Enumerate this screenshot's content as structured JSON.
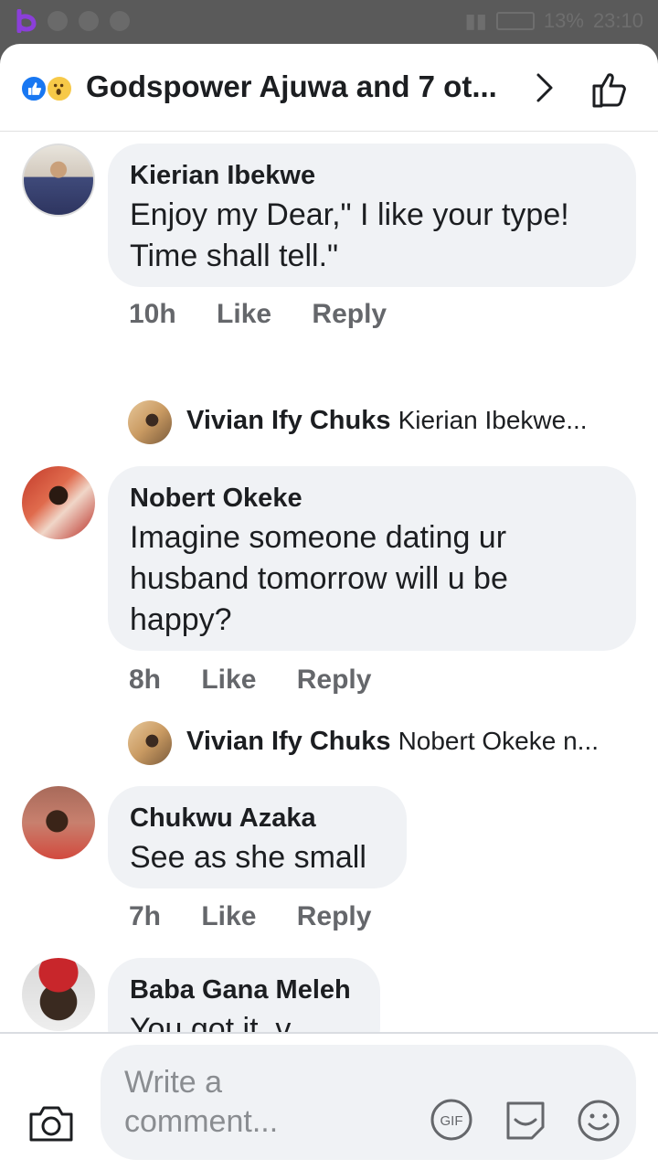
{
  "status_bar": {
    "battery": "13%",
    "time": "23:10"
  },
  "header": {
    "title": "Godspower Ajuwa and 7 ot..."
  },
  "comments": [
    {
      "author": "Kierian Ibekwe",
      "text": "Enjoy my Dear,\" I like your type! Time shall tell.\"",
      "time": "10h",
      "like": "Like",
      "reply": "Reply",
      "replies": [
        {
          "author": "Vivian Ify Chuks",
          "text": "Kierian Ibekwe..."
        }
      ]
    },
    {
      "author": "Nobert Okeke",
      "text": "Imagine someone dating ur husband tomorrow will u be happy?",
      "time": "8h",
      "like": "Like",
      "reply": "Reply",
      "replies": [
        {
          "author": "Vivian Ify Chuks",
          "text": "Nobert Okeke n..."
        }
      ]
    },
    {
      "author": "Chukwu Azaka",
      "text": "See as she small",
      "time": "7h",
      "like": "Like",
      "reply": "Reply"
    },
    {
      "author": "Baba Gana Meleh",
      "text": "You got it ,v"
    }
  ],
  "composer": {
    "placeholder": "Write a comment..."
  },
  "icons": {
    "status": [
      "app-logo-icon",
      "messenger-icon",
      "youtube-icon",
      "gallery-icon",
      "bluetooth-icon",
      "vibrate-icon",
      "wifi-icon",
      "signal-icon",
      "battery-icon"
    ],
    "header": [
      "like-reaction-icon",
      "wow-reaction-icon",
      "chevron-right-icon",
      "thumbs-up-icon"
    ],
    "composer": [
      "camera-icon",
      "gif-icon",
      "sticker-icon",
      "emoji-icon"
    ]
  },
  "colors": {
    "accent": "#1877f2",
    "bubble": "#f0f2f5",
    "secondary_text": "#65676b"
  }
}
